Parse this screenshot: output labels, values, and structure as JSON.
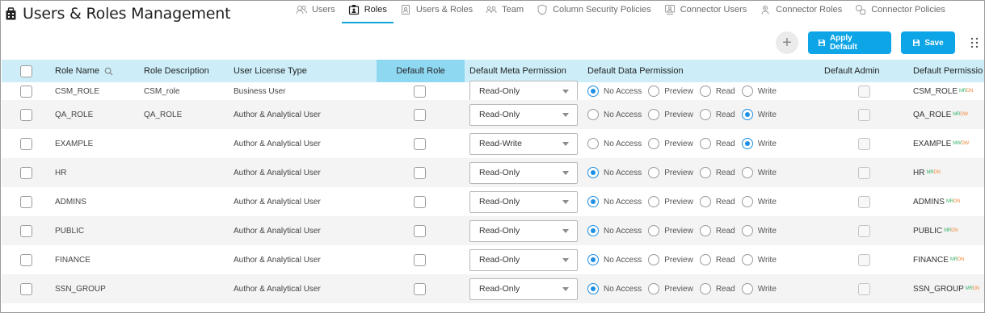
{
  "header": {
    "title": "Users & Roles Management"
  },
  "tabs": [
    {
      "label": "Users",
      "icon": "users-icon",
      "active": false
    },
    {
      "label": "Roles",
      "icon": "id-card-icon",
      "active": true
    },
    {
      "label": "Users & Roles",
      "icon": "user-card-icon",
      "active": false
    },
    {
      "label": "Team",
      "icon": "team-icon",
      "active": false
    },
    {
      "label": "Column Security Policies",
      "icon": "shield-icon",
      "active": false
    },
    {
      "label": "Connector Users",
      "icon": "connector-users-icon",
      "active": false
    },
    {
      "label": "Connector Roles",
      "icon": "connector-roles-icon",
      "active": false
    },
    {
      "label": "Connector Policies",
      "icon": "connector-policies-icon",
      "active": false
    }
  ],
  "toolbar": {
    "add_label": "+",
    "apply_default_label": "Apply Default",
    "save_label": "Save",
    "accent_color": "#0ea5e6"
  },
  "columns": {
    "role_name": "Role Name",
    "role_description": "Role Description",
    "user_license_type": "User License Type",
    "default_role": "Default Role",
    "default_meta_permission": "Default Meta Permission",
    "default_data_permission": "Default Data Permission",
    "default_admin": "Default Admin",
    "default_permission": "Default Permissio"
  },
  "radio_labels": {
    "no_access": "No Access",
    "preview": "Preview",
    "read": "Read",
    "write": "Write"
  },
  "rows": [
    {
      "name": "CSM_ROLE",
      "description": "CSM_role",
      "license": "Business User",
      "meta": "Read-Only",
      "data": "No Access",
      "perm_name": "CSM_ROLE",
      "perm_tag_a": "MR",
      "perm_tag_b": "DN"
    },
    {
      "name": "QA_ROLE",
      "description": "QA_ROLE",
      "license": "Author & Analytical User",
      "meta": "Read-Only",
      "data": "Write",
      "perm_name": "QA_ROLE",
      "perm_tag_a": "MR",
      "perm_tag_b": "DW"
    },
    {
      "name": "EXAMPLE",
      "description": "",
      "license": "Author & Analytical User",
      "meta": "Read-Write",
      "data": "Write",
      "perm_name": "EXAMPLE",
      "perm_tag_a": "MW",
      "perm_tag_b": "DW"
    },
    {
      "name": "HR",
      "description": "",
      "license": "Author & Analytical User",
      "meta": "Read-Only",
      "data": "No Access",
      "perm_name": "HR",
      "perm_tag_a": "MR",
      "perm_tag_b": "DN"
    },
    {
      "name": "ADMINS",
      "description": "",
      "license": "Author & Analytical User",
      "meta": "Read-Only",
      "data": "No Access",
      "perm_name": "ADMINS",
      "perm_tag_a": "MR",
      "perm_tag_b": "DN"
    },
    {
      "name": "PUBLIC",
      "description": "",
      "license": "Author & Analytical User",
      "meta": "Read-Only",
      "data": "No Access",
      "perm_name": "PUBLIC",
      "perm_tag_a": "MR",
      "perm_tag_b": "DN"
    },
    {
      "name": "FINANCE",
      "description": "",
      "license": "Author & Analytical User",
      "meta": "Read-Only",
      "data": "No Access",
      "perm_name": "FINANCE",
      "perm_tag_a": "MR",
      "perm_tag_b": "DN"
    },
    {
      "name": "SSN_GROUP",
      "description": "",
      "license": "Author & Analytical User",
      "meta": "Read-Only",
      "data": "No Access",
      "perm_name": "SSN_GROUP",
      "perm_tag_a": "MR",
      "perm_tag_b": "DN"
    }
  ]
}
